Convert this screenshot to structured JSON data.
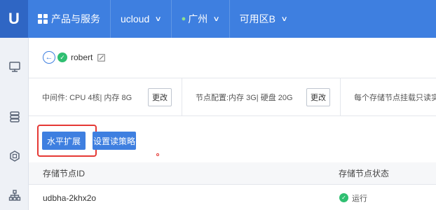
{
  "topbar": {
    "logo": "U",
    "products": "产品与服务",
    "account": "ucloud",
    "region": "广州",
    "zone": "可用区B"
  },
  "instance": {
    "name": "robert"
  },
  "info": {
    "middleware": "中间件: CPU  4核| 内存  8G",
    "node_config": "节点配置:内存  3G| 硬盘  20G",
    "node_note": "每个存储节点挂载只读实例数",
    "change_label": "更改"
  },
  "actions": {
    "scale": "水平扩展",
    "policy": "设置读策略"
  },
  "table": {
    "headers": [
      "存储节点ID",
      "存储节点状态"
    ],
    "rows": [
      {
        "id": "udbha-2khx2o",
        "status": "运行"
      }
    ]
  },
  "colors": {
    "primary": "#3e7fe0",
    "success": "#2fbf71",
    "highlight": "#e53935"
  }
}
